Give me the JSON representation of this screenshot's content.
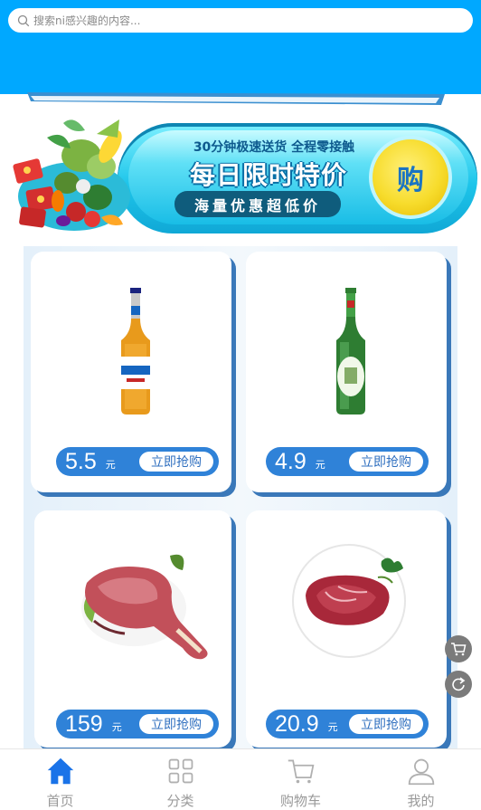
{
  "search": {
    "placeholder": "搜索ni感兴趣的内容..."
  },
  "banner": {
    "subtitle": "30分钟极速送货 全程零接触",
    "title": "每日限时特价",
    "slogan": "海量优惠超低价",
    "buy_label": "购"
  },
  "products": [
    {
      "price": "5.5",
      "unit": "元",
      "buy_label": "立即抢购",
      "image": "beer-bottle-harbin"
    },
    {
      "price": "4.9",
      "unit": "元",
      "buy_label": "立即抢购",
      "image": "beer-bottle-green"
    },
    {
      "price": "159",
      "unit": "元",
      "buy_label": "立即抢购",
      "image": "lamb-leg"
    },
    {
      "price": "20.9",
      "unit": "元",
      "buy_label": "立即抢购",
      "image": "beef-steak"
    }
  ],
  "floating": {
    "cart_icon": "cart-icon",
    "refresh_icon": "refresh-icon"
  },
  "tabbar": {
    "items": [
      {
        "label": "首页",
        "icon": "home-icon",
        "active": true
      },
      {
        "label": "分类",
        "icon": "grid-icon",
        "active": false
      },
      {
        "label": "购物车",
        "icon": "cart-icon",
        "active": false
      },
      {
        "label": "我的",
        "icon": "user-icon",
        "active": false
      }
    ]
  },
  "colors": {
    "header": "#00a8ff",
    "price_bar": "#2f82d8",
    "tab_active": "#1a73e8",
    "tab_inactive": "#9a9a9a"
  }
}
